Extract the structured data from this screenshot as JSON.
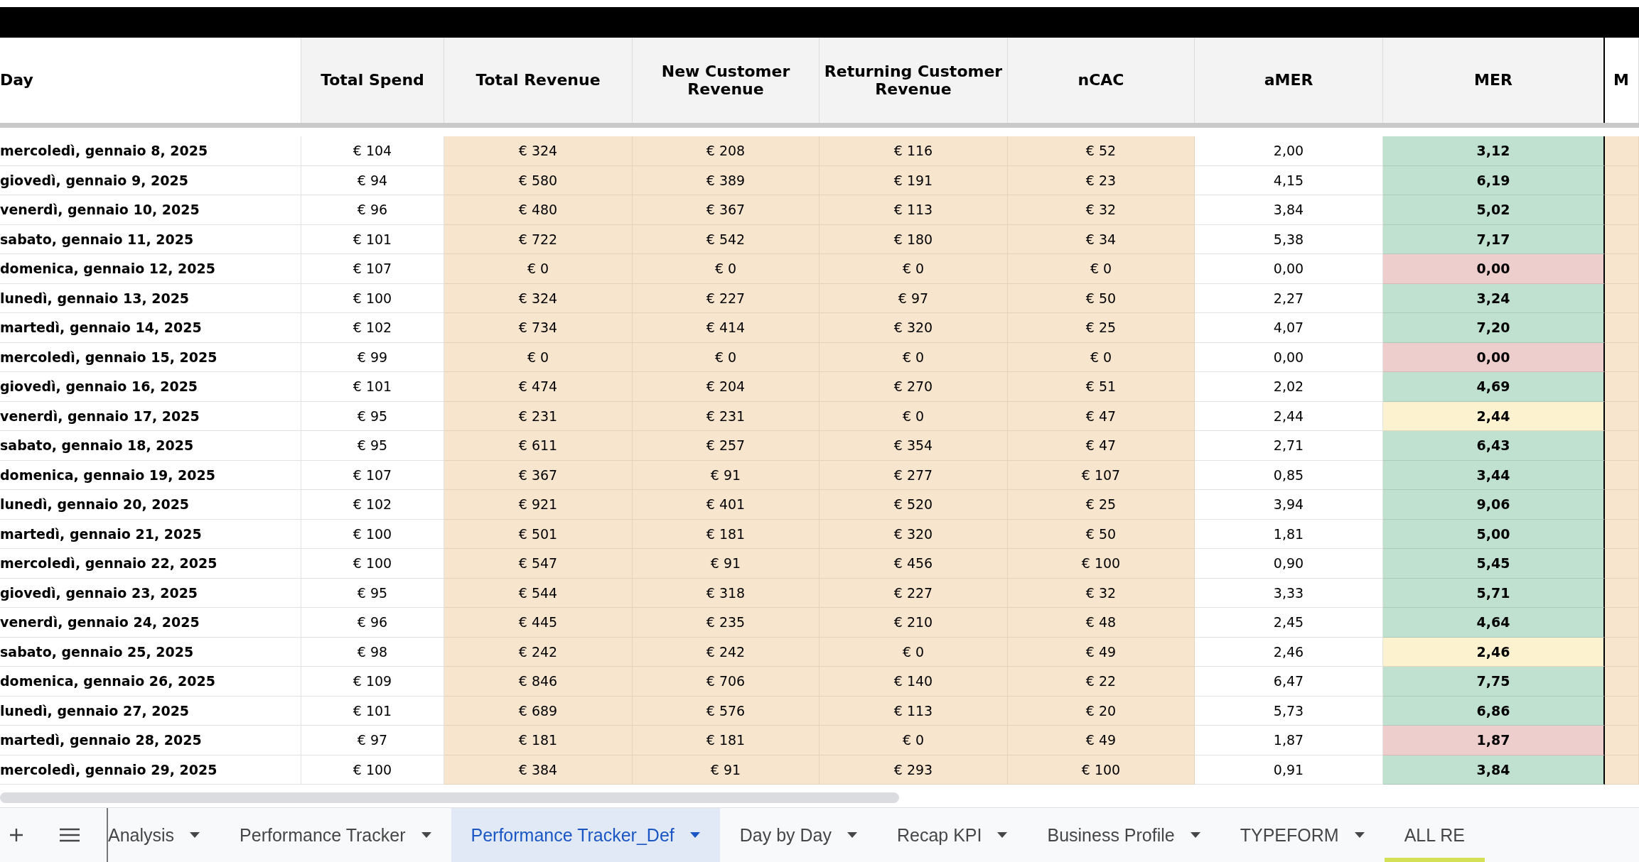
{
  "table": {
    "columns": [
      {
        "label": "Day",
        "kind": "day"
      },
      {
        "label": "Total Spend",
        "kind": "plain"
      },
      {
        "label": "Total Revenue",
        "kind": "revenue"
      },
      {
        "label": "New Customer Revenue",
        "kind": "revenue"
      },
      {
        "label": "Returning Customer Revenue",
        "kind": "revenue"
      },
      {
        "label": "nCAC",
        "kind": "revenue"
      },
      {
        "label": "aMER",
        "kind": "plain"
      },
      {
        "label": "MER",
        "kind": "mer"
      },
      {
        "label": "M",
        "kind": "revenue"
      }
    ],
    "rows": [
      {
        "cells": [
          "mercoledì, gennaio 8, 2025",
          "€ 104",
          "€ 324",
          "€ 208",
          "€ 116",
          "€ 52",
          "2,00",
          "3,12"
        ],
        "color": "#c0e0d0"
      },
      {
        "cells": [
          "giovedì, gennaio 9, 2025",
          "€ 94",
          "€ 580",
          "€ 389",
          "€ 191",
          "€ 23",
          "4,15",
          "6,19"
        ],
        "color": "#c0e0d0"
      },
      {
        "cells": [
          "venerdì, gennaio 10, 2025",
          "€ 96",
          "€ 480",
          "€ 367",
          "€ 113",
          "€ 32",
          "3,84",
          "5,02"
        ],
        "color": "#c0e0d0"
      },
      {
        "cells": [
          "sabato, gennaio 11, 2025",
          "€ 101",
          "€ 722",
          "€ 542",
          "€ 180",
          "€ 34",
          "5,38",
          "7,17"
        ],
        "color": "#c0e0d0"
      },
      {
        "cells": [
          "domenica, gennaio 12, 2025",
          "€ 107",
          "€ 0",
          "€ 0",
          "€ 0",
          "€ 0",
          "0,00",
          "0,00"
        ],
        "color": "#eecdcd"
      },
      {
        "cells": [
          "lunedì, gennaio 13, 2025",
          "€ 100",
          "€ 324",
          "€ 227",
          "€ 97",
          "€ 50",
          "2,27",
          "3,24"
        ],
        "color": "#c0e0d0"
      },
      {
        "cells": [
          "martedì, gennaio 14, 2025",
          "€ 102",
          "€ 734",
          "€ 414",
          "€ 320",
          "€ 25",
          "4,07",
          "7,20"
        ],
        "color": "#c0e0d0"
      },
      {
        "cells": [
          "mercoledì, gennaio 15, 2025",
          "€ 99",
          "€ 0",
          "€ 0",
          "€ 0",
          "€ 0",
          "0,00",
          "0,00"
        ],
        "color": "#eecdcd"
      },
      {
        "cells": [
          "giovedì, gennaio 16, 2025",
          "€ 101",
          "€ 474",
          "€ 204",
          "€ 270",
          "€ 51",
          "2,02",
          "4,69"
        ],
        "color": "#c0e0d0"
      },
      {
        "cells": [
          "venerdì, gennaio 17, 2025",
          "€ 95",
          "€ 231",
          "€ 231",
          "€ 0",
          "€ 47",
          "2,44",
          "2,44"
        ],
        "color": "#fdf2d0"
      },
      {
        "cells": [
          "sabato, gennaio 18, 2025",
          "€ 95",
          "€ 611",
          "€ 257",
          "€ 354",
          "€ 47",
          "2,71",
          "6,43"
        ],
        "color": "#c0e0d0"
      },
      {
        "cells": [
          "domenica, gennaio 19, 2025",
          "€ 107",
          "€ 367",
          "€ 91",
          "€ 277",
          "€ 107",
          "0,85",
          "3,44"
        ],
        "color": "#c0e0d0"
      },
      {
        "cells": [
          "lunedì, gennaio 20, 2025",
          "€ 102",
          "€ 921",
          "€ 401",
          "€ 520",
          "€ 25",
          "3,94",
          "9,06"
        ],
        "color": "#c0e0d0"
      },
      {
        "cells": [
          "martedì, gennaio 21, 2025",
          "€ 100",
          "€ 501",
          "€ 181",
          "€ 320",
          "€ 50",
          "1,81",
          "5,00"
        ],
        "color": "#c0e0d0"
      },
      {
        "cells": [
          "mercoledì, gennaio 22, 2025",
          "€ 100",
          "€ 547",
          "€ 91",
          "€ 456",
          "€ 100",
          "0,90",
          "5,45"
        ],
        "color": "#c0e0d0"
      },
      {
        "cells": [
          "giovedì, gennaio 23, 2025",
          "€ 95",
          "€ 544",
          "€ 318",
          "€ 227",
          "€ 32",
          "3,33",
          "5,71"
        ],
        "color": "#c0e0d0"
      },
      {
        "cells": [
          "venerdì, gennaio 24, 2025",
          "€ 96",
          "€ 445",
          "€ 235",
          "€ 210",
          "€ 48",
          "2,45",
          "4,64"
        ],
        "color": "#c0e0d0"
      },
      {
        "cells": [
          "sabato, gennaio 25, 2025",
          "€ 98",
          "€ 242",
          "€ 242",
          "€ 0",
          "€ 49",
          "2,46",
          "2,46"
        ],
        "color": "#fdf2d0"
      },
      {
        "cells": [
          "domenica, gennaio 26, 2025",
          "€ 109",
          "€ 846",
          "€ 706",
          "€ 140",
          "€ 22",
          "6,47",
          "7,75"
        ],
        "color": "#c0e0d0"
      },
      {
        "cells": [
          "lunedì, gennaio 27, 2025",
          "€ 101",
          "€ 689",
          "€ 576",
          "€ 113",
          "€ 20",
          "5,73",
          "6,86"
        ],
        "color": "#c0e0d0"
      },
      {
        "cells": [
          "martedì, gennaio 28, 2025",
          "€ 97",
          "€ 181",
          "€ 181",
          "€ 0",
          "€ 49",
          "1,87",
          "1,87"
        ],
        "color": "#eecdcd"
      },
      {
        "cells": [
          "mercoledì, gennaio 29, 2025",
          "€ 100",
          "€ 384",
          "€ 91",
          "€ 293",
          "€ 100",
          "0,91",
          "3,84"
        ],
        "color": "#c0e0d0"
      }
    ]
  },
  "sheet_tabs": [
    {
      "label": "Analysis",
      "selected": false
    },
    {
      "label": "Performance Tracker",
      "selected": false
    },
    {
      "label": "Performance Tracker_Def",
      "selected": true
    },
    {
      "label": "Day by Day",
      "selected": false
    },
    {
      "label": "Recap KPI",
      "selected": false
    },
    {
      "label": "Business Profile",
      "selected": false
    },
    {
      "label": "TYPEFORM",
      "selected": false
    },
    {
      "label": "ALL RE",
      "selected": false,
      "color": "#d4e157"
    }
  ]
}
